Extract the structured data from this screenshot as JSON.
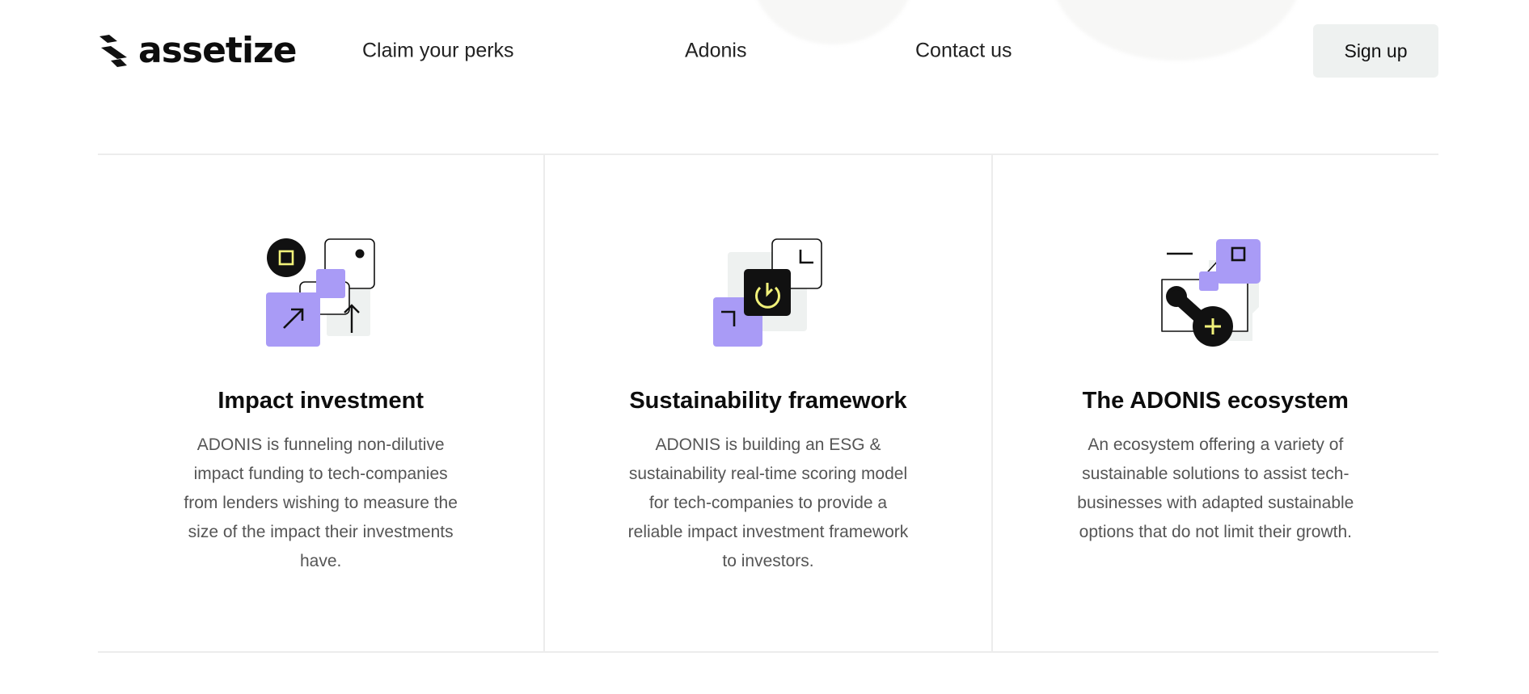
{
  "header": {
    "logo_text": "assetize",
    "nav": {
      "perks": "Claim your perks",
      "adonis": "Adonis",
      "contact": "Contact us"
    },
    "signup_label": "Sign up"
  },
  "features": [
    {
      "icon": "impact-investment-icon",
      "title": "Impact investment",
      "text": "ADONIS is funneling non-dilutive impact funding to tech-companies from lenders wishing to measure the size of the impact their investments have."
    },
    {
      "icon": "sustainability-framework-icon",
      "title": "Sustainability framework",
      "text": "ADONIS is building an ESG & sustainability real-time scoring model for tech-companies to provide a reliable impact investment framework to investors."
    },
    {
      "icon": "ecosystem-icon",
      "title": "The ADONIS ecosystem",
      "text": "An ecosystem offering a variety of sustainable solutions to assist tech-businesses with adapted sustainable options that do not limit their growth."
    }
  ],
  "colors": {
    "accent_purple": "#a99bf6",
    "accent_yellow": "#f2f27a",
    "signup_bg": "#eef1f0",
    "divider": "#ececec"
  }
}
